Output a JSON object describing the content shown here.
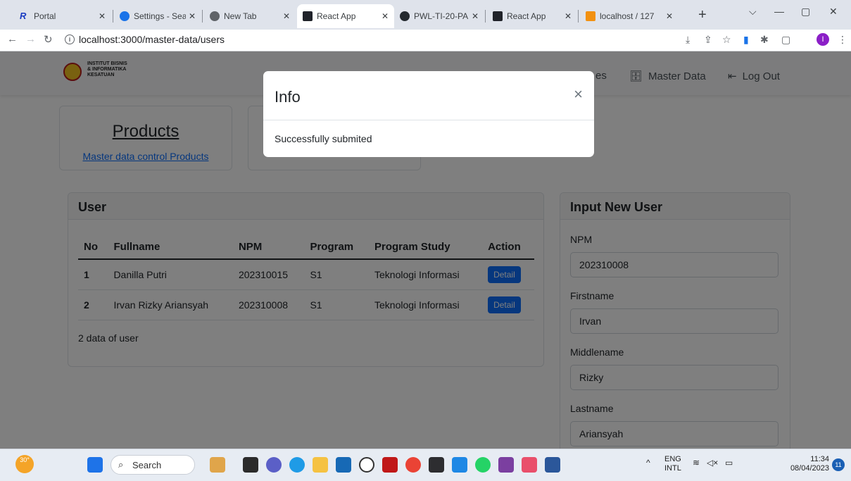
{
  "browser": {
    "tabs": [
      {
        "title": "Portal",
        "fav_color": "#1a3cc2"
      },
      {
        "title": "Settings - Sear",
        "fav_color": "#1a73e8"
      },
      {
        "title": "New Tab",
        "fav_color": "#5f6368"
      },
      {
        "title": "React App",
        "fav_color": "#20232a",
        "active": true
      },
      {
        "title": "PWL-TI-20-PA",
        "fav_color": "#24292f"
      },
      {
        "title": "React App",
        "fav_color": "#20232a"
      },
      {
        "title": "localhost / 127",
        "fav_color": "#f29111"
      }
    ],
    "url": "localhost:3000/master-data/users"
  },
  "app": {
    "logo_lines": [
      "INSTITUT BISNIS",
      "& INFORMATIKA",
      "KESATUAN"
    ],
    "nav": {
      "master_data": "Master Data",
      "logout": "Log Out",
      "partial_item": "es"
    },
    "products_card": {
      "title": "Products",
      "subtitle": "Master data control Products"
    },
    "user_card": {
      "header": "User",
      "columns": [
        "No",
        "Fullname",
        "NPM",
        "Program",
        "Program Study",
        "Action"
      ],
      "rows": [
        {
          "no": "1",
          "fullname": "Danilla Putri",
          "npm": "202310015",
          "program": "S1",
          "study": "Teknologi Informasi",
          "action": "Detail"
        },
        {
          "no": "2",
          "fullname": "Irvan Rizky Ariansyah",
          "npm": "202310008",
          "program": "S1",
          "study": "Teknologi Informasi",
          "action": "Detail"
        }
      ],
      "count_text": "2 data of user"
    },
    "form": {
      "header": "Input New User",
      "fields": [
        {
          "label": "NPM",
          "value": "202310008"
        },
        {
          "label": "Firstname",
          "value": "Irvan"
        },
        {
          "label": "Middlename",
          "value": "Rizky"
        },
        {
          "label": "Lastname",
          "value": "Ariansyah"
        }
      ]
    }
  },
  "modal": {
    "title": "Info",
    "message": "Successfully submited",
    "close": "×"
  },
  "taskbar": {
    "weather": "30°",
    "search_label": "Search",
    "lang_top": "ENG",
    "lang_bottom": "INTL",
    "time": "11:34",
    "date": "08/04/2023",
    "notif_count": "11"
  }
}
